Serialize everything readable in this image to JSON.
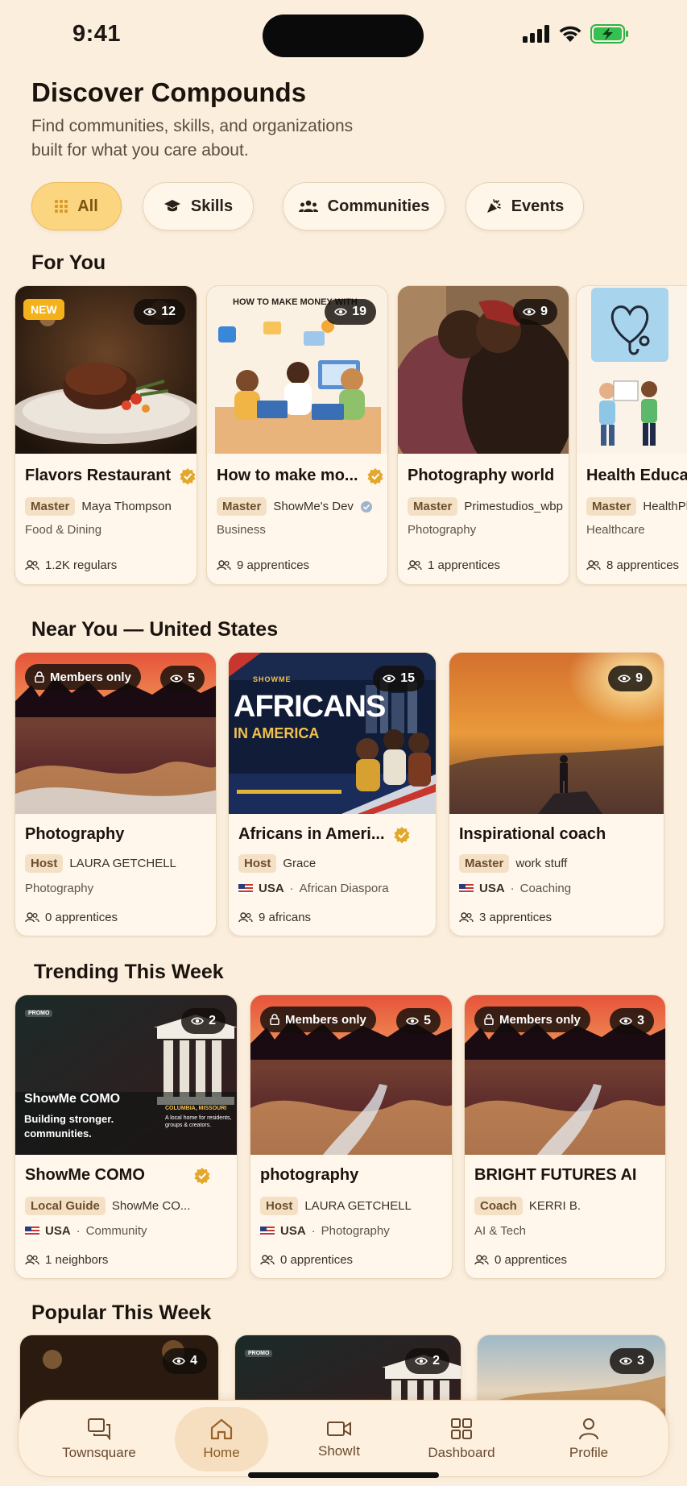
{
  "status_bar": {
    "time": "9:41"
  },
  "header": {
    "title": "Discover Compounds",
    "subtitle": "Find communities, skills, and organizations built for what you care about."
  },
  "filters": [
    {
      "label": "All",
      "icon": "grid-icon",
      "active": true
    },
    {
      "label": "Skills",
      "icon": "graduation-cap-icon"
    },
    {
      "label": "Communities",
      "icon": "people-icon"
    },
    {
      "label": "Events",
      "icon": "party-popper-icon"
    }
  ],
  "for_you": {
    "title": "For You",
    "cards": [
      {
        "title": "Flavors Restaurant",
        "badge": "NEW",
        "views": "12",
        "role": "Master",
        "person": "Maya Thompson",
        "category": "Food & Dining",
        "count": "1.2K regulars"
      },
      {
        "title": "How to make mo...",
        "thumb_text": "HOW TO MAKE MONEY WITH",
        "views": "19",
        "role": "Master",
        "person": "ShowMe's Dev",
        "category": "Business",
        "count": "9 apprentices"
      },
      {
        "title": "Photography world",
        "views": "9",
        "role": "Master",
        "person": "Primestudios_wbp",
        "category": "Photography",
        "count": "1 apprentices"
      },
      {
        "title": "Health Educar",
        "role": "Master",
        "person": "HealthPl",
        "category": "Healthcare",
        "count": "8 apprentices"
      }
    ]
  },
  "near_you": {
    "title": "Near You — United States",
    "cards": [
      {
        "title": "Photography",
        "members_only": "Members only",
        "views": "5",
        "role": "Host",
        "person": "LAURA GETCHELL",
        "category": "Photography",
        "count": "0 apprentices"
      },
      {
        "title": "Africans in Ameri...",
        "thumb_brand": "SHOWME",
        "thumb_big": "AFRICANS",
        "thumb_sub": "IN AMERICA",
        "views": "15",
        "role": "Host",
        "person": "Grace",
        "country": "USA",
        "category": "African Diaspora",
        "count": "9 africans"
      },
      {
        "title": "Inspirational coach",
        "views": "9",
        "role": "Master",
        "person": "work stuff",
        "country": "USA",
        "category": "Coaching",
        "count": "3 apprentices"
      }
    ]
  },
  "trending": {
    "title": "Trending This Week",
    "cards": [
      {
        "title": "ShowMe COMO",
        "promo": "PROMO",
        "thumb_title": "ShowMe COMO",
        "thumb_tagline": "Building stronger. communities.",
        "thumb_city": "COLUMBIA, MISSOURI",
        "thumb_desc": "A local home for residents, groups & creators.",
        "views": "2",
        "role": "Local Guide",
        "person": "ShowMe CO...",
        "country": "USA",
        "category": "Community",
        "count": "1 neighbors"
      },
      {
        "title": "photography",
        "members_only": "Members only",
        "views": "5",
        "role": "Host",
        "person": "LAURA GETCHELL",
        "country": "USA",
        "category": "Photography",
        "count": "0 apprentices"
      },
      {
        "title": "BRIGHT FUTURES AI",
        "members_only": "Members only",
        "views": "3",
        "role": "Coach",
        "person": "KERRI B.",
        "category": "AI & Tech",
        "count": "0 apprentices"
      }
    ]
  },
  "popular": {
    "title": "Popular This Week",
    "cards": [
      {
        "views": "4"
      },
      {
        "promo": "PROMO",
        "views": "2"
      },
      {
        "views": "3"
      }
    ]
  },
  "nav": [
    {
      "label": "Townsquare",
      "icon": "chat-icon"
    },
    {
      "label": "Home",
      "icon": "home-icon",
      "active": true
    },
    {
      "label": "ShowIt",
      "icon": "video-camera-icon"
    },
    {
      "label": "Dashboard",
      "icon": "dashboard-grid-icon"
    },
    {
      "label": "Profile",
      "icon": "person-icon"
    }
  ]
}
